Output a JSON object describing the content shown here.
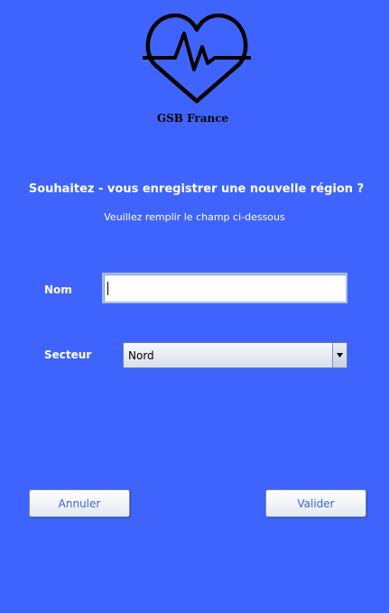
{
  "app": {
    "brand": "GSB France"
  },
  "form": {
    "title": "Souhaitez - vous enregistrer une nouvelle région ?",
    "subtitle": "Veuillez remplir le champ ci-dessous",
    "nom_label": "Nom",
    "nom_value": "",
    "secteur_label": "Secteur",
    "secteur_selected": "Nord"
  },
  "buttons": {
    "annuler": "Annuler",
    "valider": "Valider"
  },
  "icons": {
    "logo": "heart-pulse-icon",
    "dropdown": "triangle-down-icon"
  },
  "colors": {
    "background": "#3e64fd",
    "button_text": "#3a66d8"
  }
}
